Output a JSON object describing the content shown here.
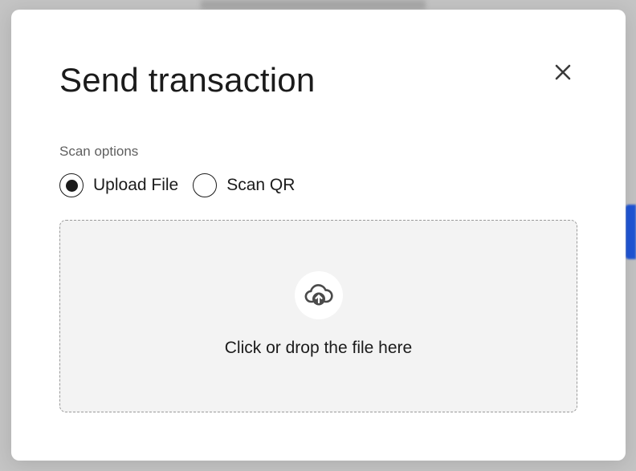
{
  "modal": {
    "title": "Send transaction",
    "close_icon": "close-icon",
    "scan_options": {
      "label": "Scan options",
      "options": [
        {
          "label": "Upload File",
          "selected": true
        },
        {
          "label": "Scan QR",
          "selected": false
        }
      ]
    },
    "dropzone": {
      "icon": "cloud-upload-icon",
      "text": "Click or drop the file here"
    }
  },
  "colors": {
    "text": "#1b1b1b",
    "muted": "#5f5f5f",
    "dropzone_bg": "#f3f3f3",
    "background_accent": "#1f55d6"
  }
}
